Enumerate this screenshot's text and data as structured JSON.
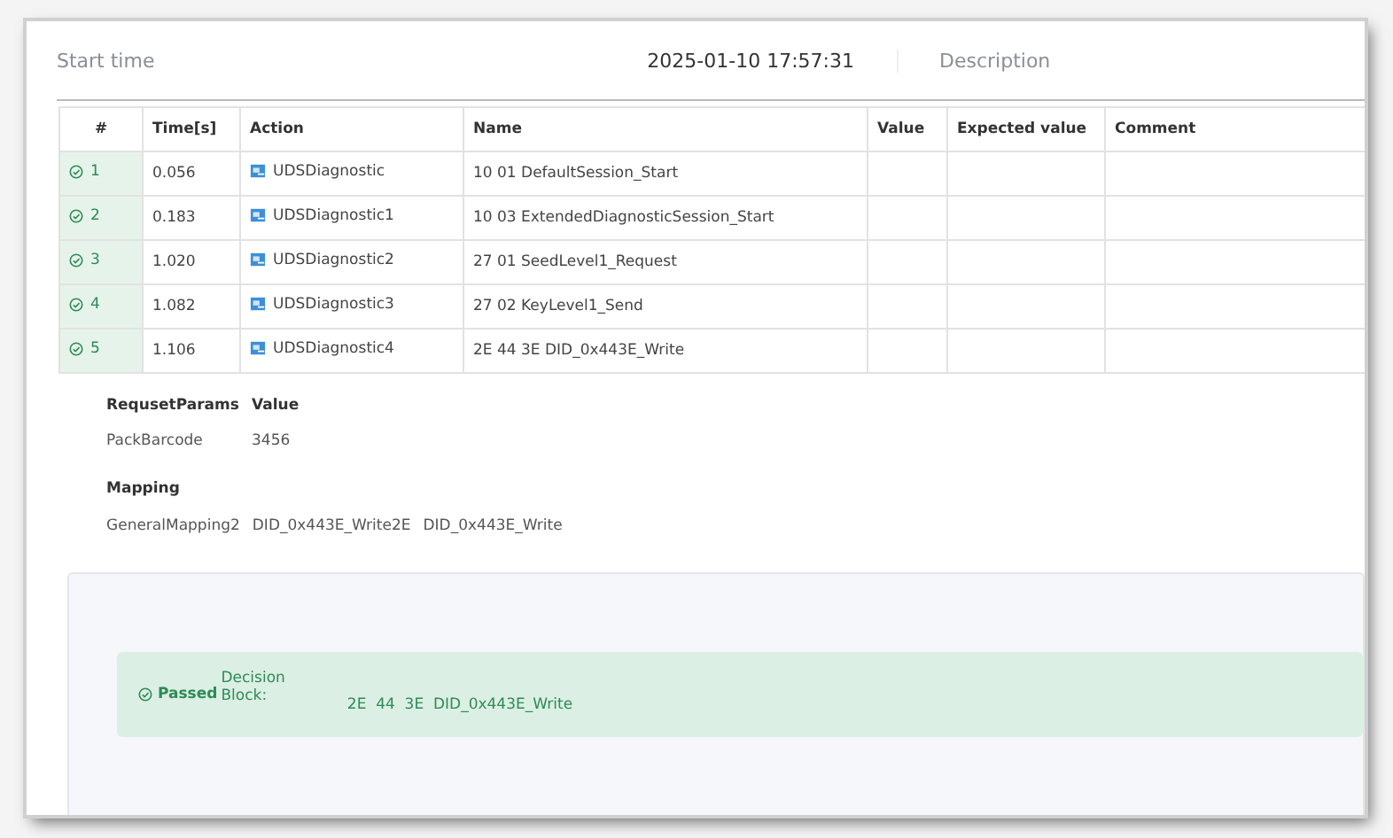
{
  "summary": {
    "label": "Start time",
    "value": "2025-01-10 17:57:31",
    "side_label": "Description"
  },
  "table": {
    "columns": [
      "#",
      "Time[s]",
      "Action",
      "Name",
      "Value",
      "Expected value",
      "Comment"
    ],
    "rows": [
      {
        "passed": true,
        "index": "1",
        "time": "0.056",
        "action": "UDSDiagnostic",
        "name": "10 01 DefaultSession_Start"
      },
      {
        "passed": true,
        "index": "2",
        "time": "0.183",
        "action": "UDSDiagnostic1",
        "name": "10 03 ExtendedDiagnosticSession_Start"
      },
      {
        "passed": true,
        "index": "3",
        "time": "1.020",
        "action": "UDSDiagnostic2",
        "name": "27 01 SeedLevel1_Request"
      },
      {
        "passed": true,
        "index": "4",
        "time": "1.082",
        "action": "UDSDiagnostic3",
        "name": "27 02 KeyLevel1_Send"
      },
      {
        "passed": true,
        "index": "5",
        "time": "1.106",
        "action": "UDSDiagnostic4",
        "name": "2E 44 3E DID_0x443E_Write"
      }
    ]
  },
  "params": {
    "headers": [
      "RequsetParams",
      "Value"
    ],
    "rows": [
      [
        "PackBarcode",
        "3456"
      ]
    ]
  },
  "mapping": {
    "title": "Mapping",
    "items": [
      "GeneralMapping2",
      "DID_0x443E_Write2E",
      "DID_0x443E_Write"
    ]
  },
  "decision": {
    "passed": true,
    "status_label": "Passed",
    "label_line1": "Decision",
    "label_line2": "Block:",
    "value": "2E  44  3E  DID_0x443E_Write"
  }
}
